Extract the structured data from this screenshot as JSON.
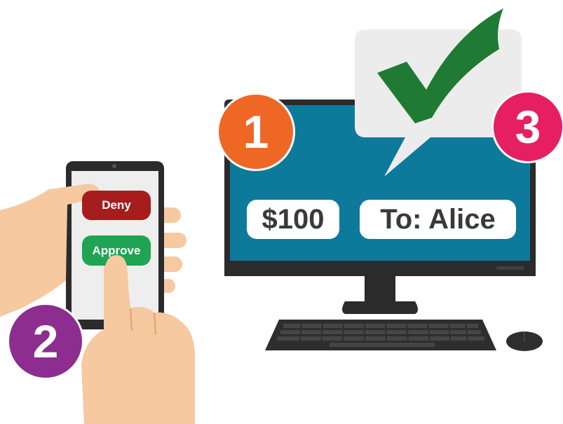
{
  "steps": {
    "one": "1",
    "two": "2",
    "three": "3"
  },
  "monitor": {
    "amount": "$100",
    "recipient": "To: Alice"
  },
  "phone": {
    "deny_label": "Deny",
    "approve_label": "Approve"
  },
  "colors": {
    "screen": "#0e7a9b",
    "bezel": "#2b2b2b",
    "deny": "#a51d1d",
    "approve": "#1ea453",
    "step1": "#ef6725",
    "step2": "#8c2d8f",
    "step3": "#e61f63",
    "checkmark": "#1f7a34",
    "skin": "#f6c9a0"
  }
}
